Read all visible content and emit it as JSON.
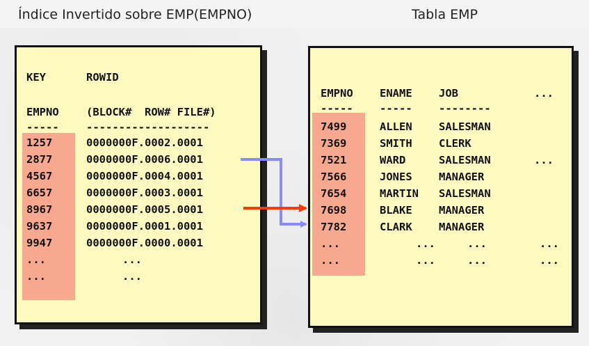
{
  "captions": {
    "left": "Índice Invertido sobre EMP(EMPNO)",
    "right": "Tabla EMP"
  },
  "index": {
    "header1": {
      "key": "KEY",
      "rowid": "ROWID"
    },
    "header2": {
      "empno": "EMPNO",
      "rowid": "(BLOCK#  ROW# FILE#)"
    },
    "sep": {
      "empno": "-----",
      "rowid": "-------------------"
    },
    "rows": [
      {
        "key": "1257",
        "rowid": "0000000F.0002.0001"
      },
      {
        "key": "2877",
        "rowid": "0000000F.0006.0001"
      },
      {
        "key": "4567",
        "rowid": "0000000F.0004.0001"
      },
      {
        "key": "6657",
        "rowid": "0000000F.0003.0001"
      },
      {
        "key": "8967",
        "rowid": "0000000F.0005.0001"
      },
      {
        "key": "9637",
        "rowid": "0000000F.0001.0001"
      },
      {
        "key": "9947",
        "rowid": "0000000F.0000.0001"
      },
      {
        "key": "...",
        "rowid": "..."
      },
      {
        "key": "...",
        "rowid": "..."
      }
    ]
  },
  "table": {
    "header": {
      "empno": "EMPNO",
      "ename": "ENAME",
      "job": "JOB",
      "more": "..."
    },
    "sep": {
      "empno": "-----",
      "ename": "-----",
      "job": "--------"
    },
    "rows": [
      {
        "empno": "7499",
        "ename": "ALLEN",
        "job": "SALESMAN",
        "more": ""
      },
      {
        "empno": "7369",
        "ename": "SMITH",
        "job": "CLERK",
        "more": ""
      },
      {
        "empno": "7521",
        "ename": "WARD",
        "job": "SALESMAN",
        "more": "..."
      },
      {
        "empno": "7566",
        "ename": "JONES",
        "job": "MANAGER",
        "more": ""
      },
      {
        "empno": "7654",
        "ename": "MARTIN",
        "job": "SALESMAN",
        "more": ""
      },
      {
        "empno": "7698",
        "ename": "BLAKE",
        "job": "MANAGER",
        "more": ""
      },
      {
        "empno": "7782",
        "ename": "CLARK",
        "job": "MANAGER",
        "more": ""
      },
      {
        "empno": "...",
        "ename": "...",
        "job": "...",
        "more": "..."
      },
      {
        "empno": "...",
        "ename": "...",
        "job": "...",
        "more": "..."
      }
    ]
  },
  "colors": {
    "panel": "#fffbc0",
    "highlight": "#f8a88e",
    "arrow_blue": "#8a8aff",
    "arrow_red": "#ff3a00"
  }
}
